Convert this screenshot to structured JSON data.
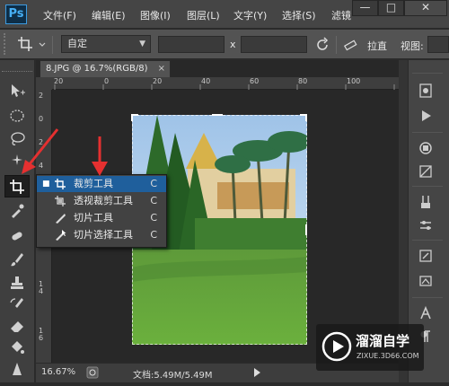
{
  "app": {
    "logo_text": "Ps"
  },
  "menu": {
    "items": [
      "文件(F)",
      "编辑(E)",
      "图像(I)",
      "图层(L)",
      "文字(Y)",
      "选择(S)",
      "滤镜"
    ],
    "window_buttons": {
      "minimize": "—",
      "restore": "□",
      "close": "✕"
    }
  },
  "options_bar": {
    "ratio_value": "自定",
    "times_sign": "x",
    "straighten_label": "拉直",
    "view_label": "视图:"
  },
  "document": {
    "tab_title": "8.JPG @ 16.7%(RGB/8)",
    "close_glyph": "×",
    "ruler_top_labels": [
      "20",
      "0",
      "20",
      "40",
      "60",
      "80",
      "100"
    ],
    "ruler_left_labels": [
      "2",
      "0",
      "2",
      "4",
      "6",
      "8",
      "1",
      "2",
      "1",
      "4",
      "1",
      "6"
    ]
  },
  "flyout": {
    "items": [
      {
        "label": "裁剪工具",
        "shortcut": "C",
        "icon": "crop-icon",
        "selected": true,
        "bullet": "■"
      },
      {
        "label": "透视裁剪工具",
        "shortcut": "C",
        "icon": "perspective-crop-icon",
        "selected": false,
        "bullet": ""
      },
      {
        "label": "切片工具",
        "shortcut": "C",
        "icon": "slice-icon",
        "selected": false,
        "bullet": ""
      },
      {
        "label": "切片选择工具",
        "shortcut": "C",
        "icon": "slice-select-icon",
        "selected": false,
        "bullet": ""
      }
    ]
  },
  "status": {
    "zoom": "16.67%",
    "doc_size": "文档:5.49M/5.49M"
  },
  "watermark": {
    "title": "溜溜自学",
    "url": "ZIXUE.3D66.COM"
  },
  "colors": {
    "accent": "#1f5f9c",
    "annotation_arrow": "#e53030"
  }
}
